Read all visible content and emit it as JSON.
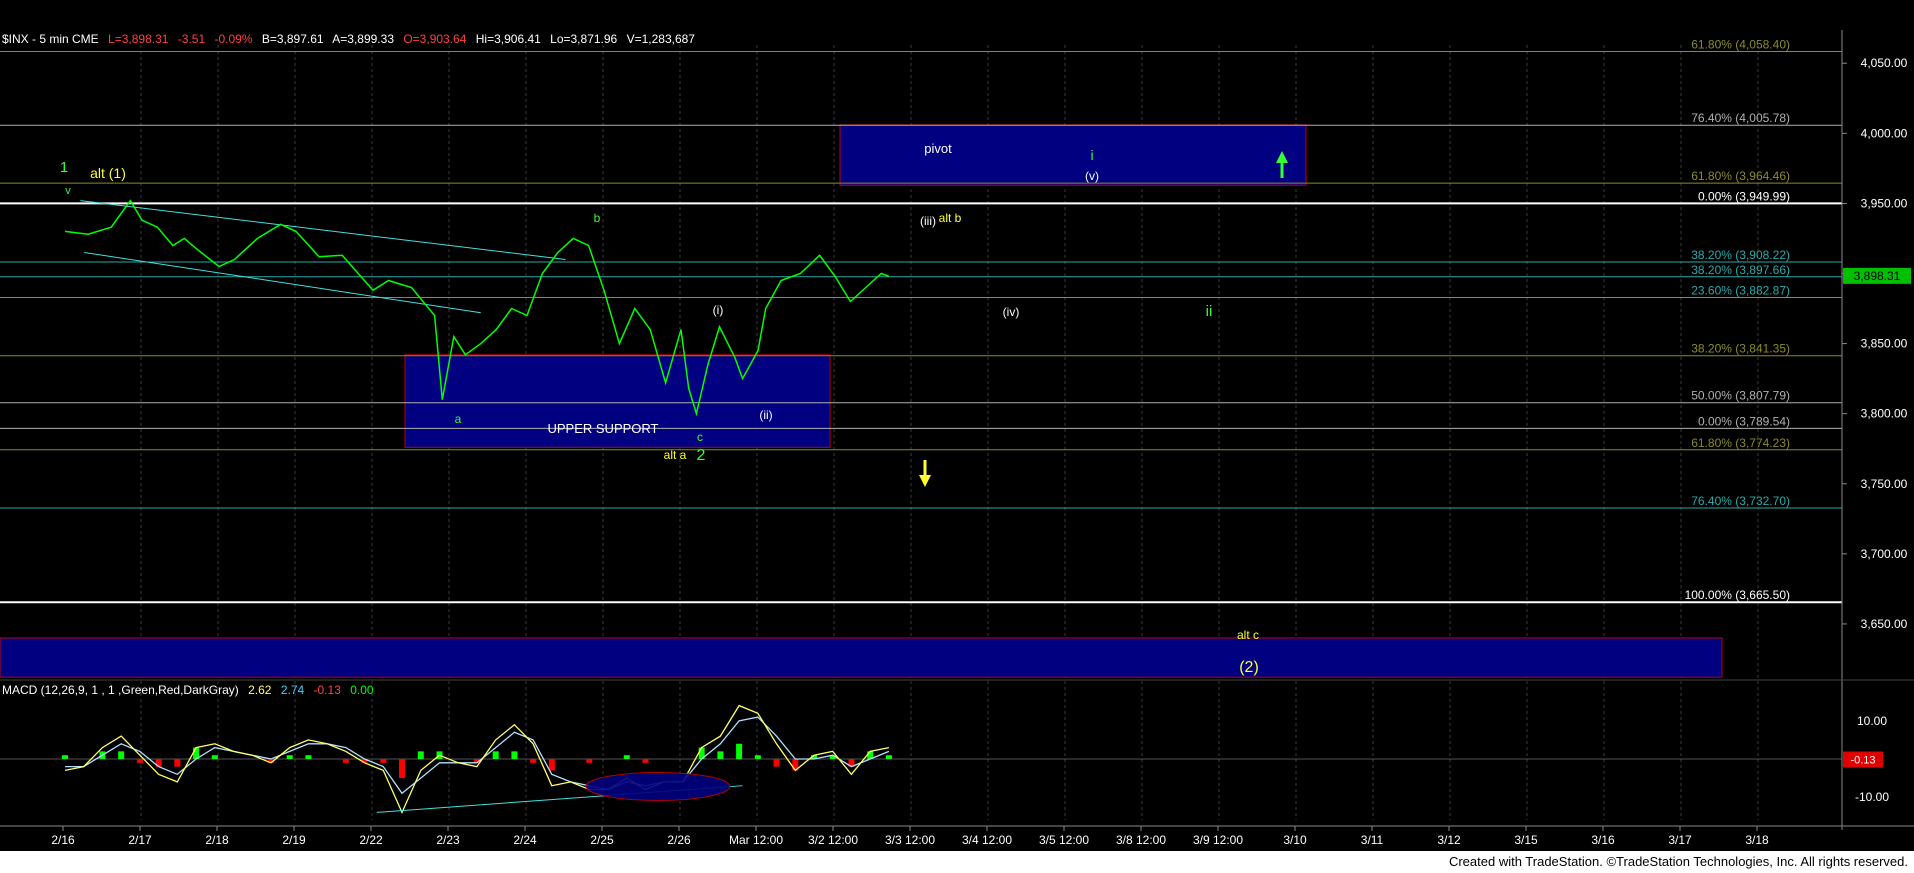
{
  "header": {
    "symbol": "$INX - 5 min  CME",
    "last": "L=3,898.31",
    "chg": "-3.51",
    "pct": "-0.09%",
    "bid": "B=3,897.61",
    "ask": "A=3,899.33",
    "open": "O=3,903.64",
    "hi": "Hi=3,906.41",
    "lo": "Lo=3,871.96",
    "vol": "V=1,283,687"
  },
  "colors": {
    "price": "#00ff00",
    "box": "#000080",
    "boxBorder": "#c00000",
    "fib_olive": "#8b8b2a",
    "fib_grey": "#b0b0b0",
    "fib_teal": "#2aa9a9",
    "label_yellow": "#ffff33",
    "label_green": "#33ff33",
    "macd_line": "#ffff66",
    "signal_line": "#b0e0ff",
    "hist_pos": "#00ff00",
    "hist_neg": "#ff0000",
    "trend": "#40e0e0"
  },
  "fib_levels": [
    {
      "label": "61.80% (4,058.40)",
      "value": 4058.4,
      "color": "olive"
    },
    {
      "label": "76.40% (4,005.78)",
      "value": 4005.78,
      "color": "grey"
    },
    {
      "label": "61.80% (3,964.46)",
      "value": 3964.46,
      "color": "olive"
    },
    {
      "label": "0.00% (3,949.99)",
      "value": 3949.99,
      "color": "white"
    },
    {
      "label": "38.20% (3,908.22)",
      "value": 3908.22,
      "color": "teal"
    },
    {
      "label": "38.20% (3,897.66)",
      "value": 3897.66,
      "color": "teal"
    },
    {
      "label": "23.60% (3,882.87)",
      "value": 3882.87,
      "color": "teal"
    },
    {
      "label": "38.20% (3,841.35)",
      "value": 3841.35,
      "color": "olive"
    },
    {
      "label": "50.00% (3,807.79)",
      "value": 3807.79,
      "color": "grey"
    },
    {
      "label": "0.00% (3,789.54)",
      "value": 3789.54,
      "color": "grey"
    },
    {
      "label": "61.80% (3,774.23)",
      "value": 3774.23,
      "color": "olive"
    },
    {
      "label": "76.40% (3,732.70)",
      "value": 3732.7,
      "color": "teal"
    },
    {
      "label": "100.00% (3,665.50)",
      "value": 3665.5,
      "color": "white"
    }
  ],
  "annotations": {
    "wave1": "1",
    "alt1": "alt (1)",
    "b": "b",
    "a": "a",
    "c": "c",
    "i_paren": "(i)",
    "ii_paren": "(ii)",
    "iii_paren": "(iii)",
    "alt_b": "alt b",
    "iv_paren": "(iv)",
    "v_paren": "(v)",
    "i": "i",
    "ii": "ii",
    "pivot": "pivot",
    "upper_support": "UPPER SUPPORT",
    "alt_a": "alt a",
    "wave2": "2",
    "alt_c": "alt c",
    "wave2_paren": "(2)"
  },
  "macd": {
    "title": "MACD (12,26,9, 1 , 1 ,Green,Red,DarkGray)",
    "v1": "2.62",
    "v2": "2.74",
    "v3": "-0.13",
    "v4": "0.00",
    "ticks": [
      "10.00",
      "-10.00"
    ],
    "last_tag": "-0.13"
  },
  "last_price_tag": "3,898.31",
  "footer": "Created with TradeStation. ©TradeStation Technologies, Inc. All rights reserved.",
  "chart_data": {
    "type": "line",
    "title": "$INX - 5 min",
    "x_tick_labels": [
      "2/16",
      "2/17",
      "2/18",
      "2/19",
      "2/22",
      "2/23",
      "2/24",
      "2/25",
      "2/26",
      "Mar 12:00",
      "3/2 12:00",
      "3/3 12:00",
      "3/4 12:00",
      "3/5 12:00",
      "3/8 12:00",
      "3/9 12:00",
      "3/10",
      "3/11",
      "3/12",
      "3/15",
      "3/16",
      "3/17",
      "3/18"
    ],
    "y_ticks": [
      "4,050.00",
      "4,000.00",
      "3,950.00",
      "3,900.00",
      "3,850.00",
      "3,800.00",
      "3,750.00",
      "3,700.00",
      "3,650.00"
    ],
    "ylim": [
      3610,
      4068
    ],
    "series": [
      {
        "points": [
          [
            0,
            3930
          ],
          [
            0.3,
            3928
          ],
          [
            0.6,
            3933
          ],
          [
            0.85,
            3952
          ],
          [
            1.0,
            3938
          ],
          [
            1.2,
            3933
          ],
          [
            1.4,
            3920
          ],
          [
            1.55,
            3925
          ],
          [
            1.7,
            3918
          ],
          [
            2.0,
            3905
          ],
          [
            2.2,
            3910
          ],
          [
            2.5,
            3925
          ],
          [
            2.8,
            3935
          ],
          [
            3.0,
            3930
          ],
          [
            3.3,
            3912
          ],
          [
            3.6,
            3913
          ],
          [
            4.0,
            3888
          ],
          [
            4.2,
            3895
          ],
          [
            4.5,
            3890
          ],
          [
            4.8,
            3870
          ],
          [
            4.9,
            3810
          ],
          [
            5.05,
            3855
          ],
          [
            5.2,
            3842
          ],
          [
            5.4,
            3850
          ],
          [
            5.6,
            3860
          ],
          [
            5.8,
            3875
          ],
          [
            6.0,
            3870
          ],
          [
            6.2,
            3900
          ],
          [
            6.4,
            3915
          ],
          [
            6.6,
            3925
          ],
          [
            6.8,
            3920
          ],
          [
            7.0,
            3888
          ],
          [
            7.2,
            3850
          ],
          [
            7.4,
            3875
          ],
          [
            7.6,
            3860
          ],
          [
            7.8,
            3822
          ],
          [
            8.0,
            3860
          ],
          [
            8.1,
            3818
          ],
          [
            8.2,
            3800
          ],
          [
            8.35,
            3835
          ],
          [
            8.5,
            3862
          ],
          [
            8.7,
            3840
          ],
          [
            8.8,
            3825
          ],
          [
            9.0,
            3845
          ],
          [
            9.1,
            3875
          ],
          [
            9.3,
            3895
          ],
          [
            9.55,
            3900
          ],
          [
            9.8,
            3913
          ],
          [
            10.0,
            3898
          ],
          [
            10.2,
            3880
          ],
          [
            10.4,
            3890
          ],
          [
            10.6,
            3900
          ],
          [
            10.7,
            3898
          ]
        ]
      }
    ],
    "macd_series": {
      "macd": [
        -3,
        -2,
        3,
        6,
        1,
        -4,
        -6,
        3,
        4,
        2,
        1,
        -1,
        3,
        5,
        4,
        2,
        -1,
        -3,
        -14,
        -3,
        1,
        -1,
        -2,
        5,
        9,
        4,
        -7,
        -6,
        -8,
        -8,
        -5,
        -8,
        -6,
        -6,
        3,
        6,
        14,
        12,
        4,
        -3,
        1,
        2,
        -4,
        2,
        3
      ],
      "signal": [
        -2,
        -2,
        1,
        4,
        2,
        -2,
        -4,
        0,
        3,
        2,
        1,
        0,
        2,
        4,
        4,
        3,
        0,
        -2,
        -9,
        -5,
        -1,
        -1,
        -1,
        3,
        7,
        5,
        -4,
        -6,
        -7,
        -8,
        -6,
        -7,
        -6,
        -6,
        0,
        4,
        10,
        11,
        6,
        0,
        0,
        1,
        -2,
        0,
        2
      ],
      "hist": [
        1,
        0,
        2,
        2,
        -1,
        -2,
        -2,
        3,
        1,
        0,
        0,
        -1,
        1,
        1,
        0,
        -1,
        -1,
        -1,
        -5,
        2,
        2,
        0,
        -1,
        2,
        2,
        -1,
        -3,
        0,
        -1,
        0,
        1,
        -1,
        0,
        0,
        3,
        2,
        4,
        1,
        -2,
        -3,
        1,
        1,
        -2,
        2,
        1
      ]
    }
  }
}
